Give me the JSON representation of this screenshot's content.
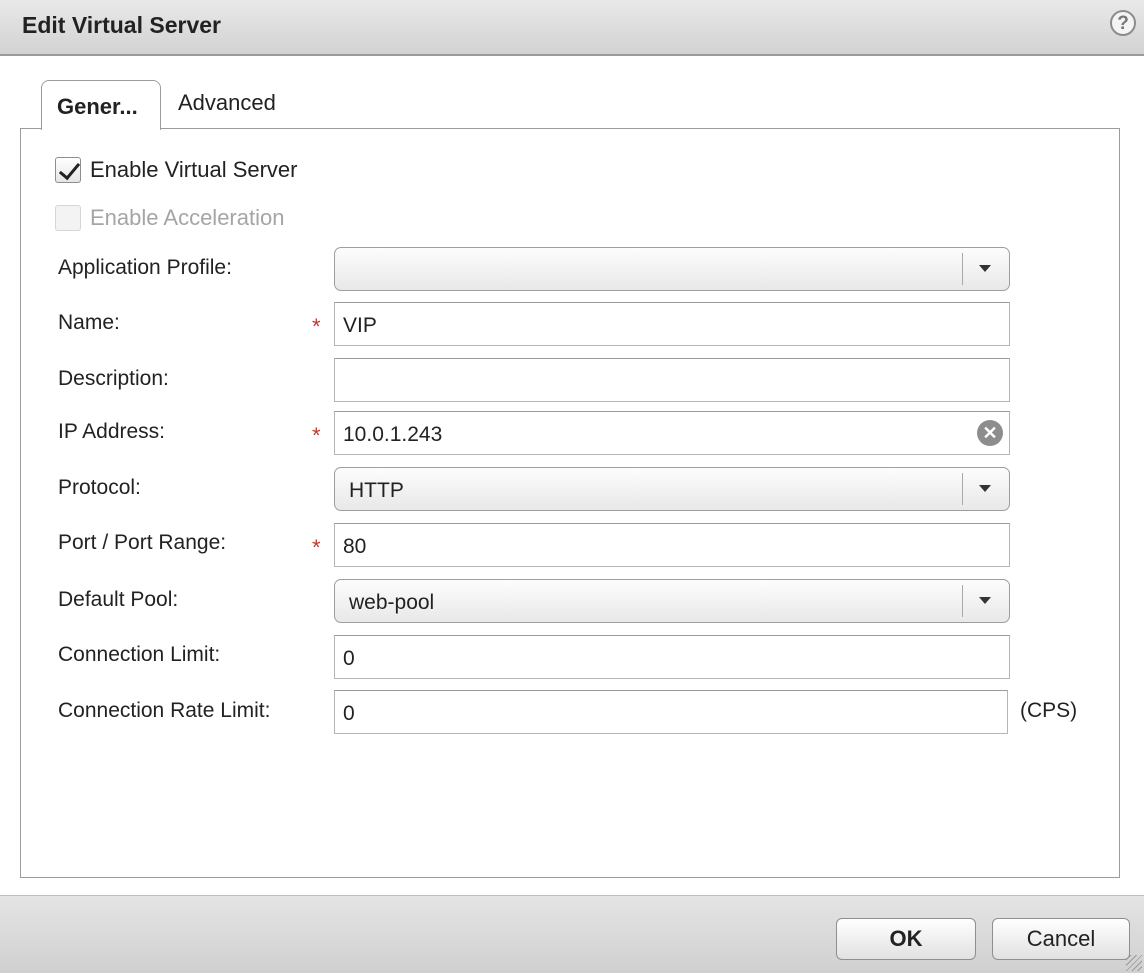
{
  "dialog": {
    "title": "Edit Virtual Server",
    "help_icon": "?"
  },
  "tabs": [
    {
      "label": "Gener...",
      "active": true
    },
    {
      "label": "Advanced",
      "active": false
    }
  ],
  "checkboxes": {
    "enable_virtual_server": {
      "label": "Enable Virtual Server",
      "checked": true
    },
    "enable_acceleration": {
      "label": "Enable Acceleration",
      "checked": false,
      "disabled": true
    }
  },
  "form": {
    "required_marker": "*",
    "application_profile": {
      "label": "Application Profile:",
      "value": ""
    },
    "name": {
      "label": "Name:",
      "value": "VIP"
    },
    "description": {
      "label": "Description:",
      "value": ""
    },
    "ip_address": {
      "label": "IP Address:",
      "value": "10.0.1.243"
    },
    "protocol": {
      "label": "Protocol:",
      "value": "HTTP"
    },
    "port_range": {
      "label": "Port / Port Range:",
      "value": "80"
    },
    "default_pool": {
      "label": "Default Pool:",
      "value": "web-pool"
    },
    "connection_limit": {
      "label": "Connection Limit:",
      "value": "0"
    },
    "connection_rate_limit": {
      "label": "Connection Rate Limit:",
      "value": "0",
      "suffix": "(CPS)"
    }
  },
  "footer": {
    "ok_label": "OK",
    "cancel_label": "Cancel"
  },
  "icons": {
    "help": "question-circle-icon",
    "clear": "clear-x-icon",
    "dropdown": "caret-down-icon",
    "check": "checkmark-icon"
  },
  "colors": {
    "required": "#c0392b",
    "title_bar": "#d9d9d9",
    "disabled_text": "#a5a5a5"
  }
}
